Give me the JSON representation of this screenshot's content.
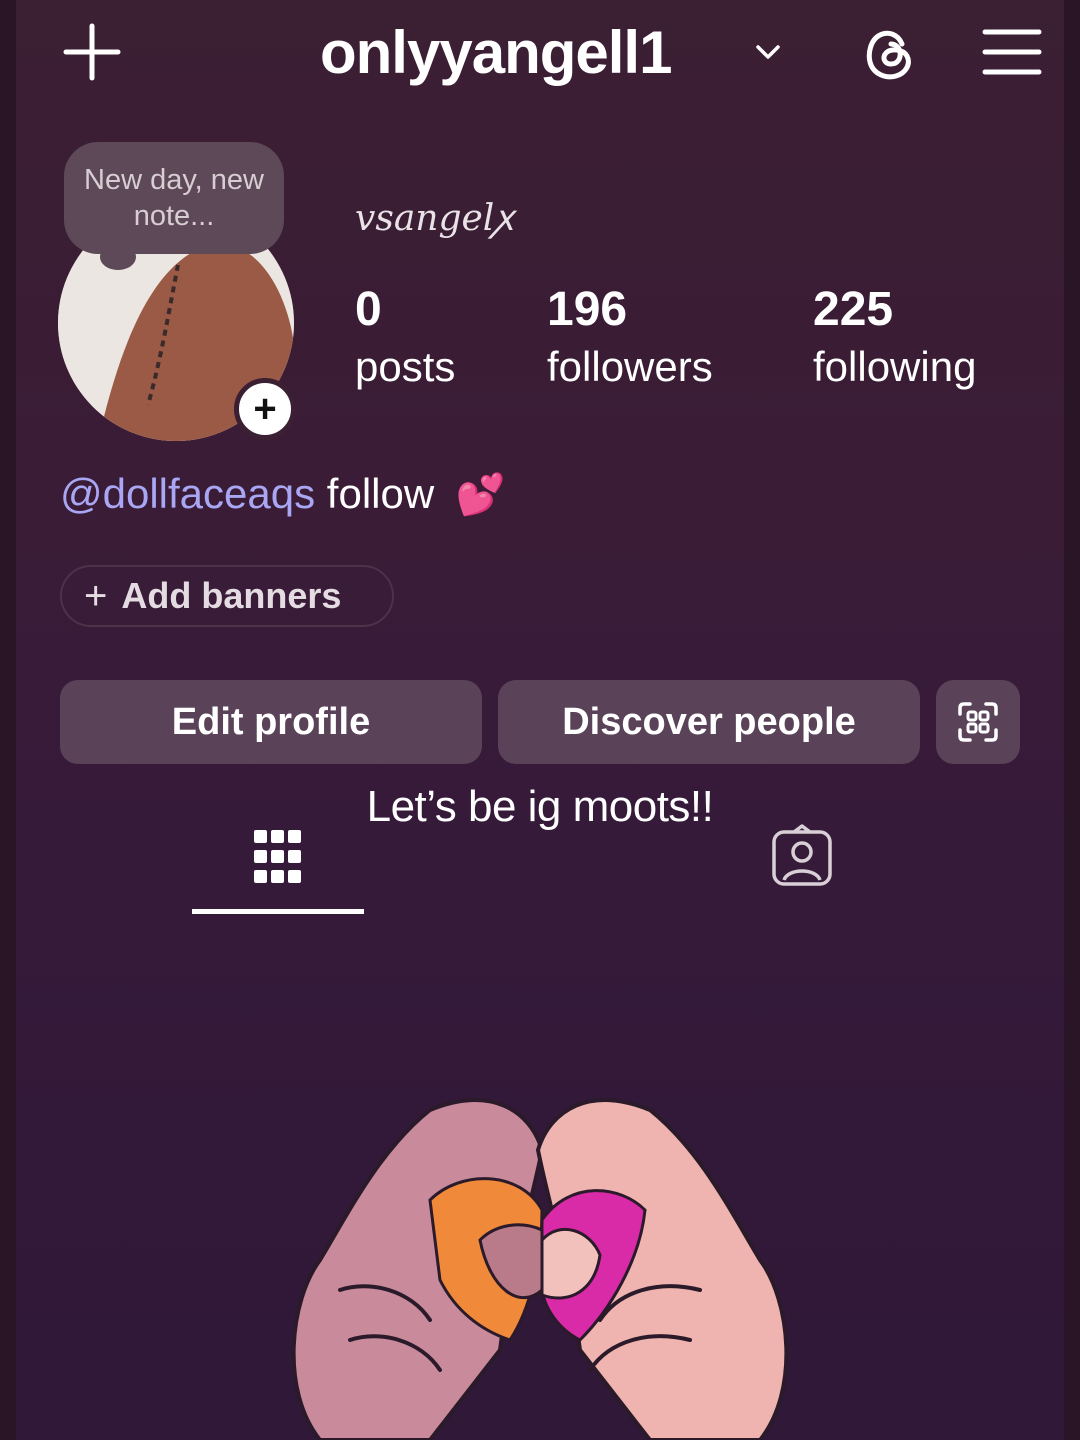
{
  "header": {
    "username": "onlyyangell1",
    "icons": [
      "plus-icon",
      "chevron-down-icon",
      "threads-icon",
      "menu-icon"
    ]
  },
  "profile": {
    "note": "New day, new note...",
    "display_name": "vsangelꭗ",
    "stats": [
      {
        "value": "0",
        "label": "posts"
      },
      {
        "value": "196",
        "label": "followers"
      },
      {
        "value": "225",
        "label": "following"
      }
    ],
    "bio_mention": "@dollfaceaqs",
    "bio_text": "follow",
    "bio_emoji": "💕",
    "add_banners_label": "Add banners"
  },
  "actions": {
    "edit_profile": "Edit profile",
    "discover_people": "Discover people"
  },
  "caption": "Let’s be ig moots!!",
  "tabs": [
    "grid-icon",
    "tagged-icon"
  ],
  "colors": {
    "background": "#3a1c36",
    "button": "#5a4358",
    "mention": "#a9a6f4",
    "note_bubble": "#5d4957"
  }
}
